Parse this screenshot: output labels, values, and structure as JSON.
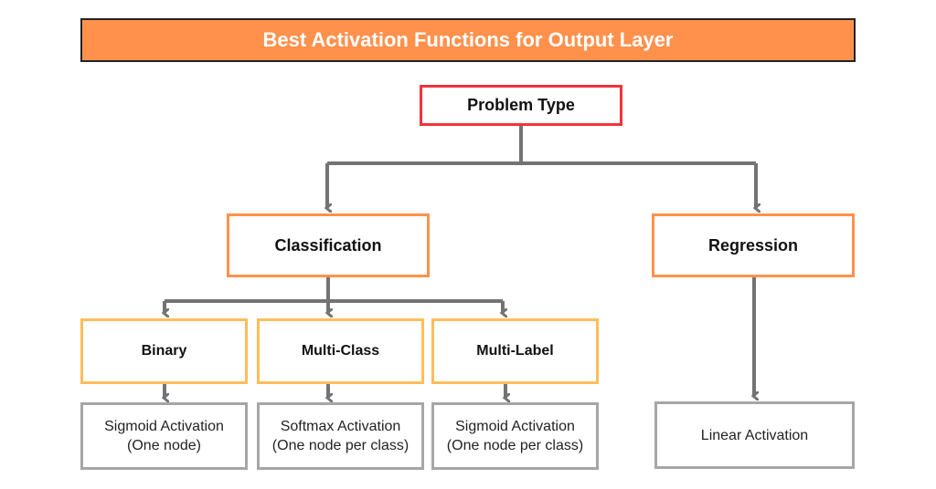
{
  "title": "Best Activation Functions for Output Layer",
  "root": {
    "label": "Problem Type"
  },
  "categories": [
    {
      "label": "Classification"
    },
    {
      "label": "Regression"
    }
  ],
  "classification_types": [
    {
      "label": "Binary",
      "activation_line1": "Sigmoid Activation",
      "activation_line2": "(One node)"
    },
    {
      "label": "Multi-Class",
      "activation_line1": "Softmax Activation",
      "activation_line2": "(One node per class)"
    },
    {
      "label": "Multi-Label",
      "activation_line1": "Sigmoid Activation",
      "activation_line2": "(One node per class)"
    }
  ],
  "regression_activation": {
    "label": "Linear Activation"
  },
  "colors": {
    "title_fill": "#ff914d",
    "root_border": "#f0343c",
    "category_border": "#ff914d",
    "type_border": "#ffbd59",
    "leaf_border": "#a6a6a6",
    "connector": "#737373"
  }
}
